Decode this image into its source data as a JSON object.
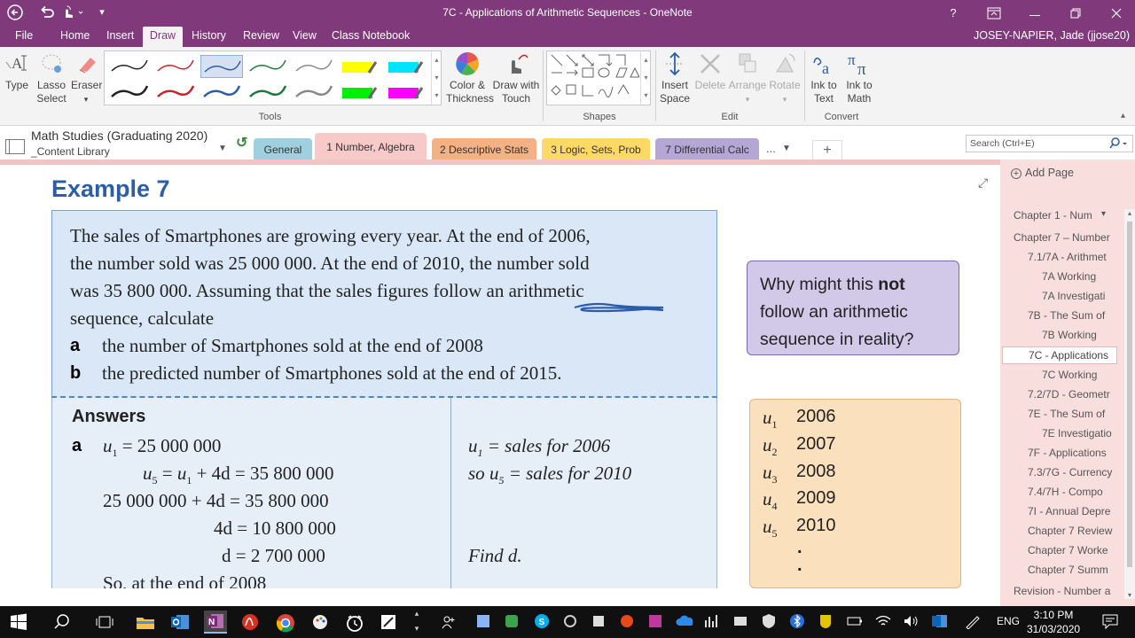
{
  "window": {
    "title": "7C - Applications of Arithmetic Sequences - OneNote",
    "help": "?",
    "qat": {
      "back": "back-icon",
      "undo": "undo-icon",
      "touch": "touch-mode-icon",
      "customize": "customize-icon"
    }
  },
  "menu": {
    "items": [
      "File",
      "Home",
      "Insert",
      "Draw",
      "History",
      "Review",
      "View",
      "Class Notebook"
    ],
    "active": "Draw",
    "user": "JOSEY-NAPIER, Jade (jjose20)"
  },
  "ribbon": {
    "tools_group": {
      "label": "Tools",
      "type": "Type",
      "lasso": [
        "Lasso",
        "Select"
      ],
      "eraser": "Eraser",
      "pens_row1": [
        "#222222",
        "#c8222a",
        "#2a5caa",
        "#1a7a3a",
        "#888888",
        "#ffff00",
        "#00e5ff"
      ],
      "pens_row2": [
        "#222222",
        "#c8222a",
        "#2a5caa",
        "#1a7a3a",
        "#888888",
        "#00ee00",
        "#ff00ff"
      ],
      "color_thickness": [
        "Color &",
        "Thickness"
      ],
      "draw_touch": [
        "Draw with",
        "Touch"
      ]
    },
    "shapes_group": {
      "label": "Shapes"
    },
    "edit_group": {
      "label": "Edit",
      "insert_space": [
        "Insert",
        "Space"
      ],
      "delete": "Delete",
      "arrange": "Arrange",
      "rotate": "Rotate"
    },
    "convert_group": {
      "label": "Convert",
      "ink_text": [
        "Ink to",
        "Text"
      ],
      "ink_math": [
        "Ink to",
        "Math"
      ]
    }
  },
  "notebook": {
    "name": "Math Studies (Graduating 2020)",
    "section_group": "_Content Library",
    "tabs": [
      {
        "label": "General",
        "color": "#9ed0e0"
      },
      {
        "label": "1 Number, Algebra",
        "color": "#f8c9c9"
      },
      {
        "label": "2 Descriptive Stats",
        "color": "#f4b183"
      },
      {
        "label": "3 Logic, Sets, Prob",
        "color": "#ffd966"
      },
      {
        "label": "7 Differential Calc",
        "color": "#b4a7d6"
      }
    ],
    "more": "...",
    "add": "+",
    "search_placeholder": "Search (Ctrl+E)"
  },
  "content": {
    "heading": "Example 7",
    "question_lines": [
      "The sales of Smartphones are growing every year. At the end of 2006,",
      "the number sold was 25 000 000. At the end of 2010, the number sold",
      "was 35 800 000. Assuming that the sales figures follow an arithmetic",
      "sequence, calculate"
    ],
    "parts": [
      {
        "letter": "a",
        "text": "the number of Smartphones sold at the end of 2008"
      },
      {
        "letter": "b",
        "text": "the predicted number of Smartphones sold at the end of 2015."
      }
    ],
    "answers_heading": "Answers",
    "answer_letter": "a",
    "working": {
      "l1": "= 25 000 000",
      "l2a": "=",
      "l2b": "+ 4d = 35 800 000",
      "l3": "25 000 000 + 4d = 35 800 000",
      "l4": "4d = 10 800 000",
      "l5": "d = 2 700 000",
      "l6": "So, at the end of 2008"
    },
    "notes": {
      "n1": "= sales for 2006",
      "n2a": "so",
      "n2b": "= sales for 2010",
      "n3": "Find d."
    },
    "callout": {
      "pre": "Why might this ",
      "bold": "not",
      "post": "follow an arithmetic sequence in reality?"
    },
    "sequence": [
      {
        "sub": "1",
        "year": "2006"
      },
      {
        "sub": "2",
        "year": "2007"
      },
      {
        "sub": "3",
        "year": "2008"
      },
      {
        "sub": "4",
        "year": "2009"
      },
      {
        "sub": "5",
        "year": "2010"
      }
    ],
    "dots": "."
  },
  "pages": {
    "add_label": "Add Page",
    "items": [
      {
        "label": "Chapter 1 - Num",
        "indent": 0
      },
      {
        "label": "Chapter 7 – Number",
        "indent": 0
      },
      {
        "label": "7.1/7A - Arithmet",
        "indent": 1
      },
      {
        "label": "7A Working",
        "indent": 2
      },
      {
        "label": "7A Investigati",
        "indent": 2
      },
      {
        "label": "7B - The Sum of",
        "indent": 1
      },
      {
        "label": "7B Working",
        "indent": 2
      },
      {
        "label": "7C - Applications",
        "indent": 1,
        "selected": true
      },
      {
        "label": "7C Working",
        "indent": 2
      },
      {
        "label": "7.2/7D - Geometr",
        "indent": 1
      },
      {
        "label": "7E - The Sum of",
        "indent": 1
      },
      {
        "label": "7E Investigatio",
        "indent": 2
      },
      {
        "label": "7F - Applications",
        "indent": 1
      },
      {
        "label": "7.3/7G - Currency",
        "indent": 1
      },
      {
        "label": "7.4/7H - Compo",
        "indent": 1
      },
      {
        "label": "7I - Annual Depre",
        "indent": 1
      },
      {
        "label": "Chapter 7 Review",
        "indent": 1
      },
      {
        "label": "Chapter 7 Worke",
        "indent": 1
      },
      {
        "label": "Chapter 7 Summ",
        "indent": 1
      },
      {
        "label": "Revision - Number a",
        "indent": 0
      }
    ]
  },
  "taskbar": {
    "time": "3:10 PM",
    "date": "31/03/2020",
    "lang": "ENG"
  }
}
